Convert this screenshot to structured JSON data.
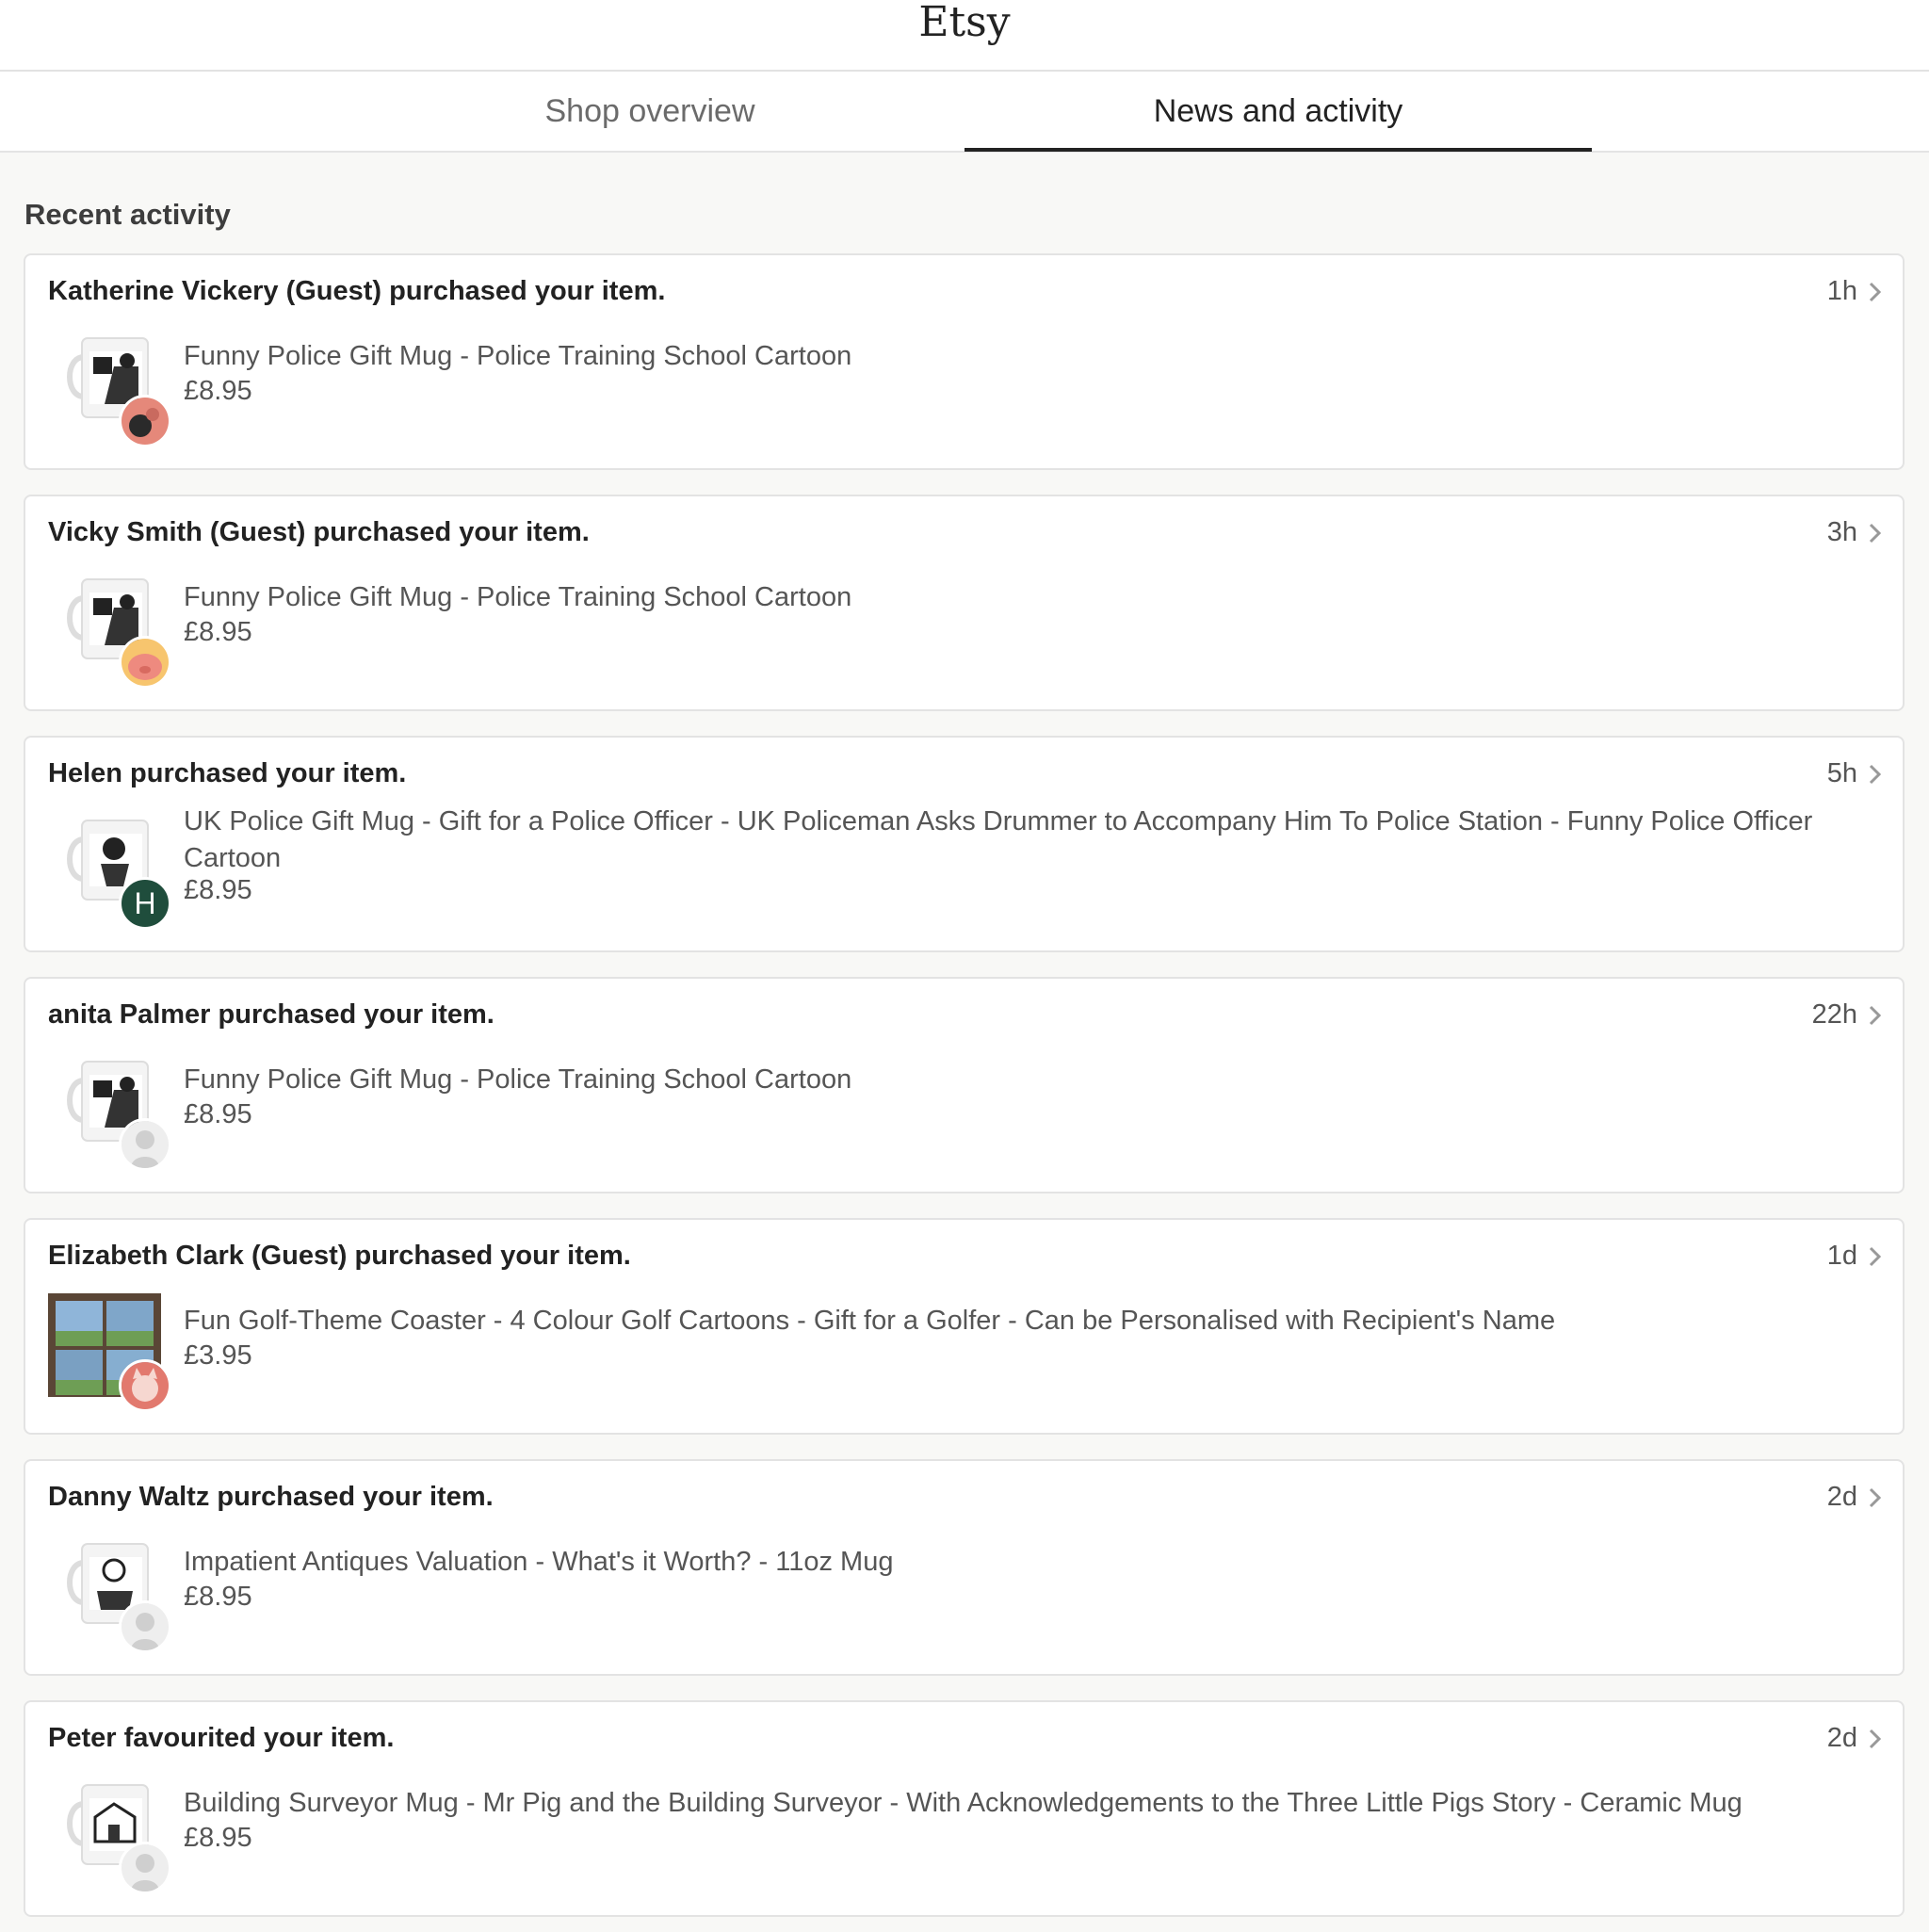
{
  "header": {
    "brand": "Etsy"
  },
  "tabs": [
    {
      "label": "Shop overview",
      "active": false
    },
    {
      "label": "News and activity",
      "active": true
    }
  ],
  "section": {
    "title": "Recent activity"
  },
  "activities": [
    {
      "actor": "Katherine Vickery",
      "action": "(Guest) purchased your item.",
      "time": "1h",
      "item": "Funny Police Gift Mug - Police Training School Cartoon",
      "price": "£8.95",
      "avatar": "dog-avatar-icon"
    },
    {
      "actor": "Vicky Smith (Guest)",
      "action": "purchased your item.",
      "time": "3h",
      "item": "Funny Police Gift Mug - Police Training School Cartoon",
      "price": "£8.95",
      "avatar": "pig-avatar-icon"
    },
    {
      "actor": "Helen",
      "action": "purchased your item.",
      "time": "5h",
      "item": "UK Police Gift Mug - Gift for a Police Officer - UK Policeman Asks Drummer to Accompany Him To Police Station - Funny Police Officer Cartoon",
      "price": "£8.95",
      "avatar": "H"
    },
    {
      "actor": "anita Palmer",
      "action": "purchased your item.",
      "time": "22h",
      "item": "Funny Police Gift Mug - Police Training School Cartoon",
      "price": "£8.95",
      "avatar": "default-person-icon"
    },
    {
      "actor": "Elizabeth Clark",
      "action": "(Guest) purchased your item.",
      "time": "1d",
      "item": "Fun Golf-Theme Coaster - 4 Colour Golf Cartoons - Gift for a Golfer - Can be Personalised with Recipient's Name",
      "price": "£3.95",
      "avatar": "cat-avatar-icon"
    },
    {
      "actor": "Danny Waltz",
      "action": "purchased your item.",
      "time": "2d",
      "item": "Impatient Antiques Valuation - What's it Worth? - 11oz Mug",
      "price": "£8.95",
      "avatar": "default-person-icon"
    },
    {
      "actor": "Peter",
      "action": "favourited your item.",
      "time": "2d",
      "item": "Building Surveyor Mug - Mr Pig and the Building Surveyor - With Acknowledgements to the Three Little Pigs Story - Ceramic Mug",
      "price": "£8.95",
      "avatar": "default-person-icon"
    }
  ],
  "colors": {
    "accent": "#222222",
    "background": "#f8f8f6",
    "avatar_h": "#1f4d3c"
  }
}
